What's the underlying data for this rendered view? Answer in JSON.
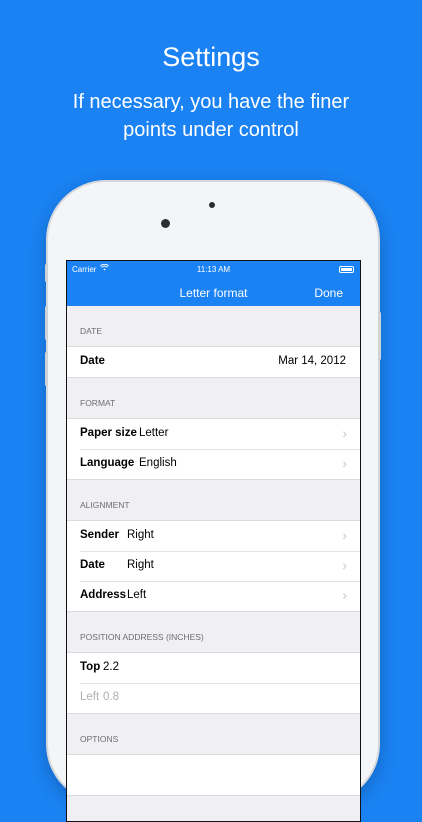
{
  "promo": {
    "title": "Settings",
    "subtitle": "If necessary, you have the finer points under control"
  },
  "status_bar": {
    "carrier": "Carrier",
    "time": "11:13 AM"
  },
  "nav": {
    "title": "Letter format",
    "done_label": "Done"
  },
  "sections": {
    "date": {
      "header": "DATE",
      "rows": [
        {
          "label": "Date",
          "value": "Mar 14, 2012"
        }
      ]
    },
    "format": {
      "header": "FORMAT",
      "rows": [
        {
          "label": "Paper size",
          "value": "Letter"
        },
        {
          "label": "Language",
          "value": "English"
        }
      ]
    },
    "alignment": {
      "header": "ALIGNMENT",
      "rows": [
        {
          "label": "Sender",
          "value": "Right"
        },
        {
          "label": "Date",
          "value": "Right"
        },
        {
          "label": "Address",
          "value": "Left"
        }
      ]
    },
    "position": {
      "header": "POSITION ADDRESS (INCHES)",
      "rows": [
        {
          "label": "Top",
          "value": "2.2"
        },
        {
          "label": "Left",
          "value": "0.8"
        }
      ]
    },
    "options": {
      "header": "OPTIONS"
    }
  },
  "colors": {
    "accent": "#1a82f2",
    "background": "#efeff4",
    "chevron": "#c7c7cc"
  },
  "icons": {
    "row_disclosure": "chevron-right-icon",
    "wifi": "wifi-icon",
    "battery": "battery-icon"
  }
}
